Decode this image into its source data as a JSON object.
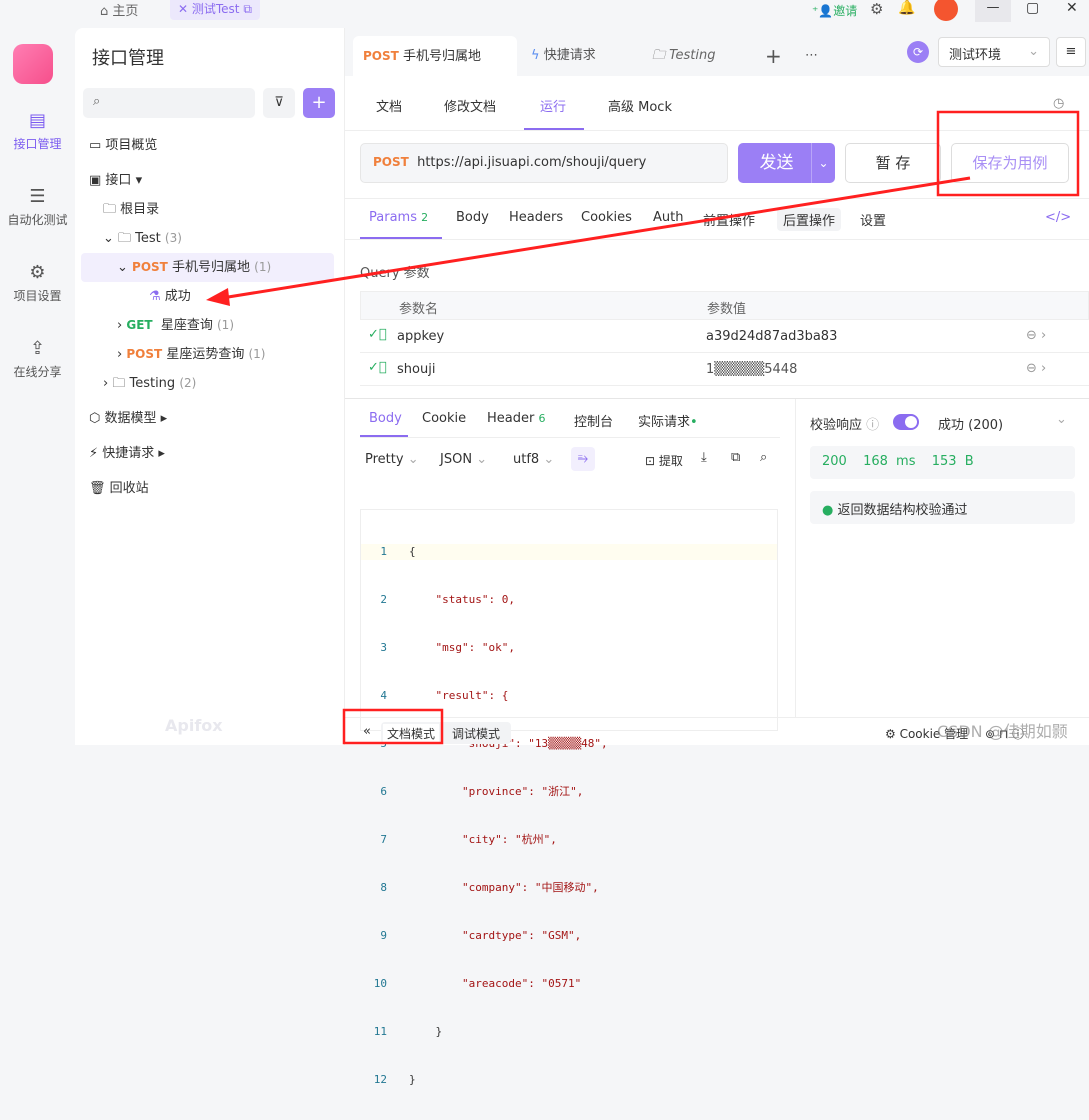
{
  "topbar": {
    "home": "主页",
    "tab": "测试Test",
    "invite": "邀请"
  },
  "rail": {
    "items": [
      {
        "label": "接口管理"
      },
      {
        "label": "自动化测试"
      },
      {
        "label": "项目设置"
      },
      {
        "label": "在线分享"
      }
    ]
  },
  "sidebar": {
    "title": "接口管理",
    "search_placeholder": "",
    "items": {
      "overview": "项目概览",
      "api": "接口",
      "root": "根目录",
      "test": "Test",
      "test_count": "(3)",
      "post1_method": "POST",
      "post1": "手机号归属地",
      "post1_count": "(1)",
      "case": "成功",
      "get_method": "GET",
      "get1": "星座查询",
      "get1_count": "(1)",
      "post2_method": "POST",
      "post2": "星座运势查询",
      "post2_count": "(1)",
      "testing": "Testing",
      "testing_count": "(2)",
      "schema": "数据模型",
      "quick": "快捷请求",
      "trash": "回收站"
    },
    "watermark": "Apifox"
  },
  "tabs": [
    {
      "method": "POST",
      "label": "手机号归属地"
    },
    {
      "label": "快捷请求"
    },
    {
      "label": "Testing"
    }
  ],
  "env": "测试环境",
  "subtabs": [
    "文档",
    "修改文档",
    "运行",
    "高级 Mock"
  ],
  "request": {
    "method": "POST",
    "url": "https://api.jisuapi.com/shouji/query",
    "send": "发送",
    "save": "暂 存",
    "save_case": "保存为用例"
  },
  "param_tabs": {
    "params": "Params",
    "params_count": "2",
    "body": "Body",
    "headers": "Headers",
    "cookies": "Cookies",
    "auth": "Auth",
    "pre": "前置操作",
    "post": "后置操作",
    "settings": "设置"
  },
  "query": {
    "title": "Query 参数",
    "col_name": "参数名",
    "col_value": "参数值",
    "rows": [
      {
        "name": "appkey",
        "value": "a39d24d87ad3ba83"
      },
      {
        "name": "shouji",
        "value": "1▒▒▒▒▒5448"
      }
    ]
  },
  "response": {
    "tabs": {
      "body": "Body",
      "cookie": "Cookie",
      "header": "Header",
      "header_count": "6",
      "console": "控制台",
      "actual": "实际请求"
    },
    "format": "Pretty",
    "type": "JSON",
    "encoding": "utf8",
    "extract": "提取",
    "lines": [
      "{",
      "    \"status\": 0,",
      "    \"msg\": \"ok\",",
      "    \"result\": {",
      "        \"shouji\": \"13▒▒▒▒▒48\",",
      "        \"province\": \"浙江\",",
      "        \"city\": \"杭州\",",
      "        \"company\": \"中国移动\",",
      "        \"cardtype\": \"GSM\",",
      "        \"areacode\": \"0571\"",
      "    }",
      "}"
    ]
  },
  "validate": {
    "label": "校验响应",
    "status": "成功 (200)",
    "code": "200",
    "time": "168 ms",
    "size": "153 B",
    "result": "返回数据结构校验通过"
  },
  "bottom": {
    "doc_mode": "文档模式",
    "debug_mode": "调试模式",
    "cookie": "Cookie 管理",
    "watermark": "CSDN @佳期如颢"
  },
  "colors": {
    "accent": "#8b6cf0",
    "annotation": "#ff0000",
    "post": "#f0803c",
    "get": "#27ae60"
  }
}
